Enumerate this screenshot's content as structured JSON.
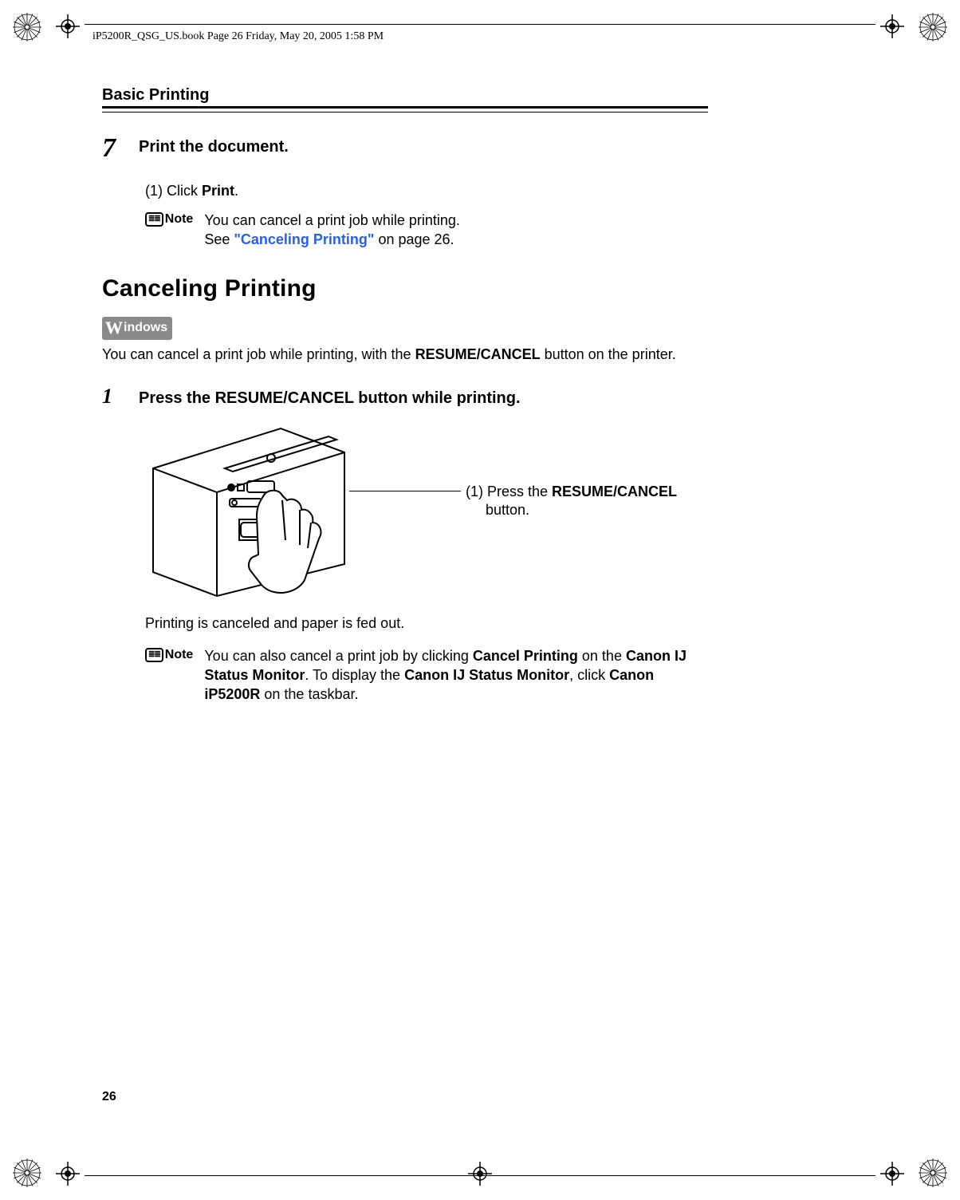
{
  "header": {
    "running_text": "iP5200R_QSG_US.book  Page 26  Friday, May 20, 2005  1:58 PM"
  },
  "section_title": "Basic Printing",
  "step7": {
    "number": "7",
    "title": "Print the document.",
    "sub": {
      "label": "(1)",
      "text_prefix": "Click ",
      "text_bold": "Print",
      "text_suffix": "."
    },
    "note": {
      "label": "Note",
      "line1": "You can cancel a print job while printing.",
      "line2_prefix": "See ",
      "line2_link": "\"Canceling Printing\"",
      "line2_suffix": " on page 26."
    }
  },
  "heading": "Canceling Printing",
  "os_badge": {
    "w": "W",
    "rest": "indows"
  },
  "intro": {
    "prefix": "You can cancel a print job while printing, with the ",
    "bold": "RESUME/CANCEL",
    "suffix": " button on the printer."
  },
  "step1": {
    "number": "1",
    "title_prefix": "Press the ",
    "title_bold": "RESUME/CANCEL",
    "title_suffix": " button while printing."
  },
  "callout": {
    "prefix": "(1) Press the ",
    "bold": "RESUME/CANCEL",
    "suffix_line": "button."
  },
  "after_figure": "Printing is canceled and paper is fed out.",
  "note2": {
    "label": "Note",
    "t1": "You can also cancel a print job by clicking ",
    "b1": "Cancel Printing",
    "t2": " on the ",
    "b2": "Canon IJ Status Monitor",
    "t3": ". To display the ",
    "b3": "Canon IJ Status Monitor",
    "t4": ", click ",
    "b4": "Canon iP5200R",
    "t5": " on the taskbar."
  },
  "page_number": "26"
}
